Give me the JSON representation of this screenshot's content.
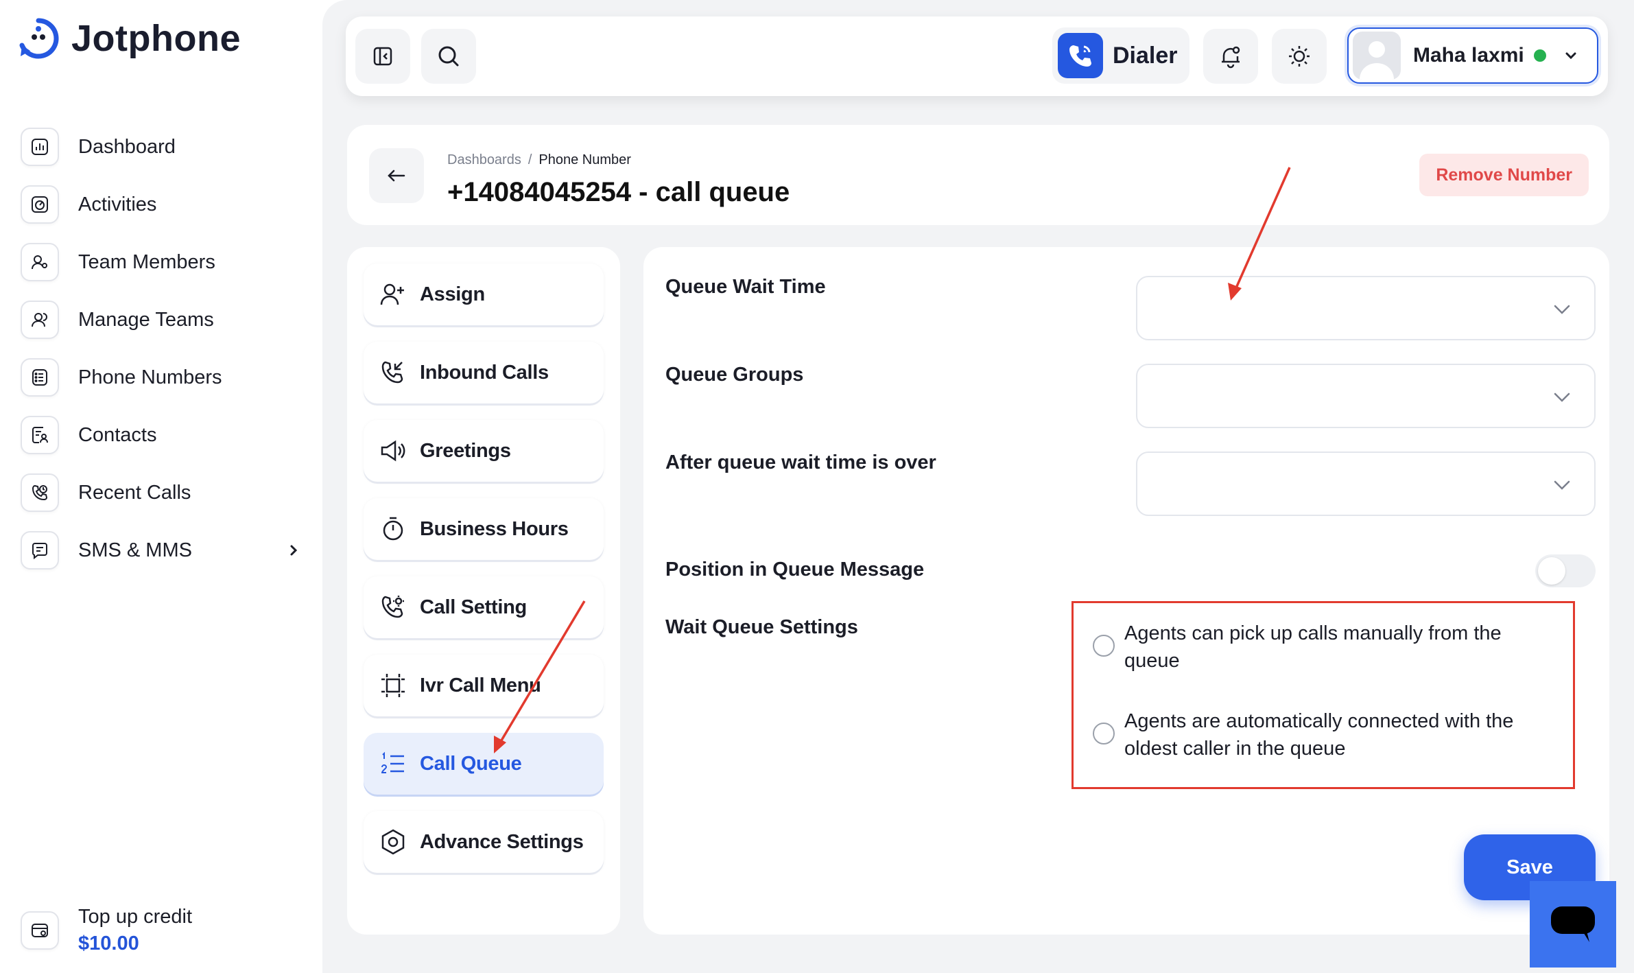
{
  "brand": {
    "name": "Jotphone"
  },
  "sidebar": {
    "items": [
      {
        "label": "Dashboard",
        "icon": "chart-bar-icon"
      },
      {
        "label": "Activities",
        "icon": "gauge-icon"
      },
      {
        "label": "Team Members",
        "icon": "user-settings-icon"
      },
      {
        "label": "Manage Teams",
        "icon": "users-icon"
      },
      {
        "label": "Phone Numbers",
        "icon": "list-card-icon"
      },
      {
        "label": "Contacts",
        "icon": "contact-book-icon"
      },
      {
        "label": "Recent Calls",
        "icon": "phone-history-icon"
      },
      {
        "label": "SMS & MMS",
        "icon": "message-icon"
      }
    ],
    "credit": {
      "label": "Top up credit",
      "amount": "$10.00"
    }
  },
  "topbar": {
    "dialer_label": "Dialer",
    "user_name": "Maha laxmi",
    "status_color": "#26b150"
  },
  "page": {
    "breadcrumb": [
      "Dashboards",
      "Phone Number"
    ],
    "breadcrumb_sep": "/",
    "title": "+14084045254 - call queue",
    "remove_label": "Remove Number"
  },
  "submenu": {
    "active": "Call Queue",
    "items": [
      {
        "label": "Assign",
        "icon": "user-plus-icon"
      },
      {
        "label": "Inbound Calls",
        "icon": "phone-incoming-icon"
      },
      {
        "label": "Greetings",
        "icon": "megaphone-icon"
      },
      {
        "label": "Business Hours",
        "icon": "stopwatch-icon"
      },
      {
        "label": "Call Setting",
        "icon": "phone-gear-icon"
      },
      {
        "label": "Ivr Call Menu",
        "icon": "frame-icon"
      },
      {
        "label": "Call Queue",
        "icon": "numbered-list-icon"
      },
      {
        "label": "Advance Settings",
        "icon": "hex-settings-icon"
      }
    ]
  },
  "form": {
    "queue_wait_time": {
      "label": "Queue Wait Time",
      "value": ""
    },
    "queue_groups": {
      "label": "Queue Groups",
      "value": ""
    },
    "after_wait": {
      "label": "After queue wait time is over",
      "value": ""
    },
    "position_message": {
      "label": "Position in Queue Message",
      "enabled": false
    },
    "wait_settings": {
      "label": "Wait Queue Settings",
      "options": [
        "Agents can pick up calls manually from the queue",
        "Agents are automatically connected with the oldest caller in the queue"
      ]
    },
    "save_label": "Save"
  },
  "colors": {
    "accent": "#2558e0",
    "annotation": "#e23a2e",
    "danger_text": "#e04848",
    "danger_bg": "#fde8e8"
  }
}
